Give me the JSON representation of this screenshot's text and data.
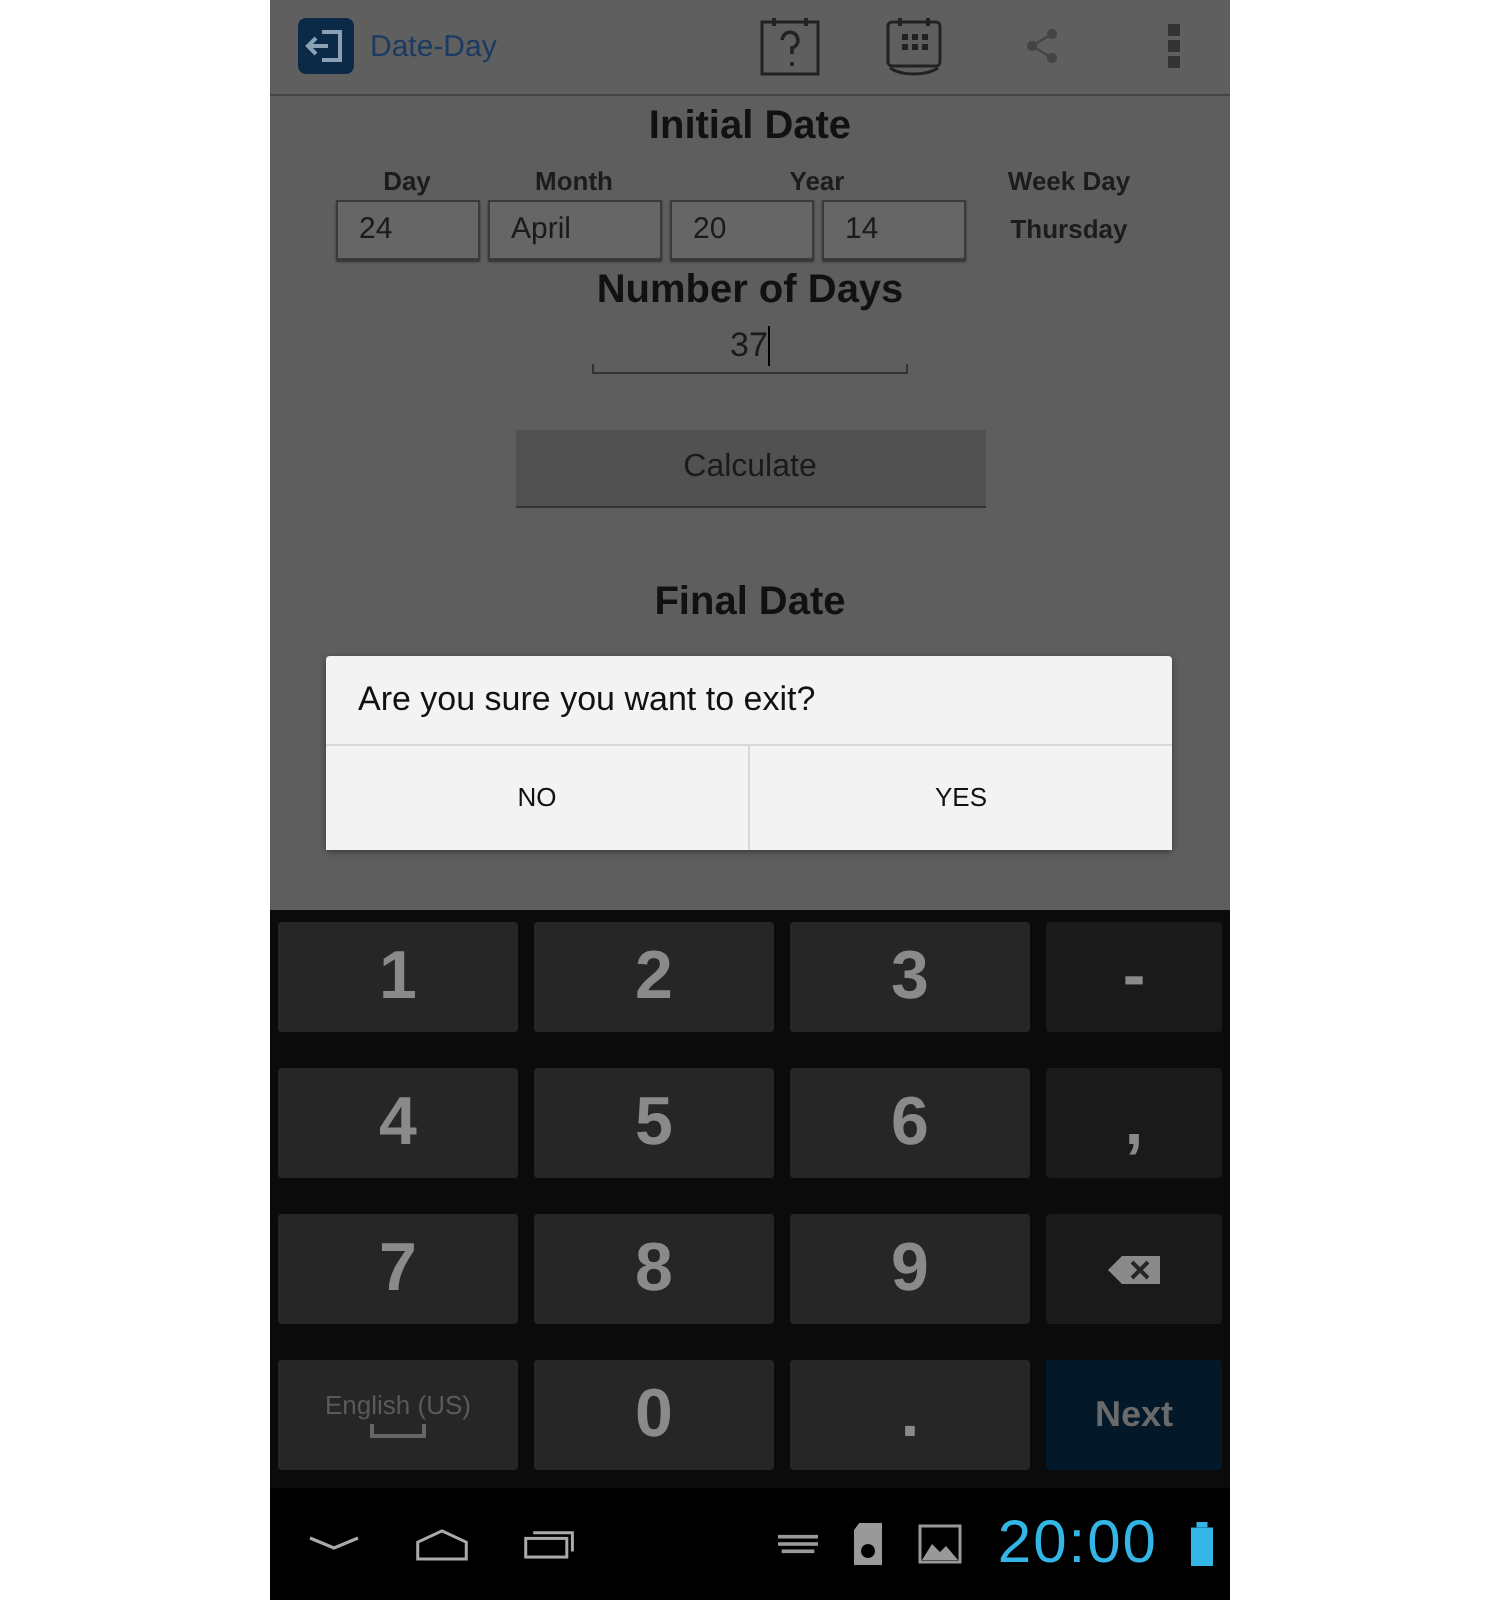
{
  "action_bar": {
    "title": "Date-Day"
  },
  "initial_date": {
    "heading": "Initial Date",
    "day_label": "Day",
    "month_label": "Month",
    "year_label": "Year",
    "week_day_label": "Week Day",
    "day": "24",
    "month": "April",
    "year_century": "20",
    "year_short": "14",
    "week_day": "Thursday"
  },
  "days": {
    "heading": "Number of Days",
    "value": "37"
  },
  "calculate_button": "Calculate",
  "final_date": {
    "heading": "Final Date"
  },
  "dialog": {
    "message": "Are you sure you want to exit?",
    "buttons": [
      "NO",
      "YES"
    ]
  },
  "keyboard": {
    "keys": [
      {
        "kind": "digit",
        "label": "1"
      },
      {
        "kind": "digit",
        "label": "2"
      },
      {
        "kind": "digit",
        "label": "3"
      },
      {
        "kind": "symbol",
        "label": "-"
      },
      {
        "kind": "digit",
        "label": "4"
      },
      {
        "kind": "digit",
        "label": "5"
      },
      {
        "kind": "digit",
        "label": "6"
      },
      {
        "kind": "symbol",
        "label": ","
      },
      {
        "kind": "digit",
        "label": "7"
      },
      {
        "kind": "digit",
        "label": "8"
      },
      {
        "kind": "digit",
        "label": "9"
      },
      {
        "kind": "backspace"
      },
      {
        "kind": "space",
        "label": "English (US)"
      },
      {
        "kind": "digit",
        "label": "0"
      },
      {
        "kind": "digit",
        "label": "."
      },
      {
        "kind": "action",
        "label": "Next"
      }
    ]
  },
  "status_bar": {
    "time": "20:00"
  }
}
